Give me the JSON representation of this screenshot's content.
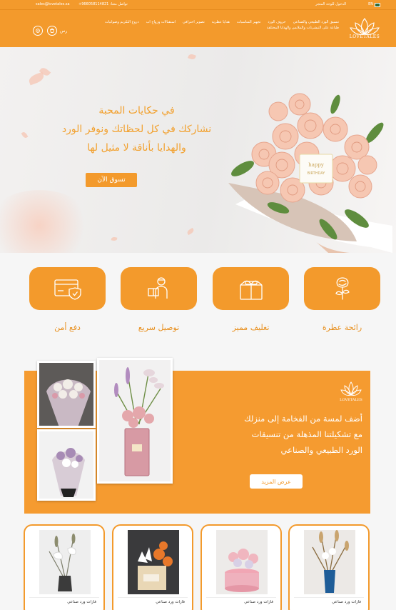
{
  "topbar": {
    "email": "sales@lovetales.sa",
    "phone": "+966058114821 :تواصل معنا",
    "login": "الدخول للوحة المتجر",
    "lang": "EN"
  },
  "header": {
    "logo_text": "LOVETALES",
    "nav": [
      "تنسيق الورد الطبيعي والصناعي",
      "حروف الورد",
      "تجهيز المناسبات",
      "هدايا عطرية",
      "تصوير احترافي",
      "استقبالات وزواج اب",
      "دروع التكريم وصوانيات",
      "طباعة على التيشرتات والملابس والهدايا المختلفة"
    ],
    "cart_label": "رس"
  },
  "hero": {
    "line1": "في حكايات المحبة",
    "line2": "نشاركك في كل لحظاتك ونوفر الورد",
    "line3": "والهدايا بأناقة لا مثيل لها",
    "shop_button": "تسوق الآن",
    "card_text": "happy BIRTHDAY"
  },
  "features": [
    {
      "label": "رائحة عطرة",
      "icon": "rose-icon"
    },
    {
      "label": "تغليف مميز",
      "icon": "gift-box-icon"
    },
    {
      "label": "توصيل سريع",
      "icon": "delivery-man-icon"
    },
    {
      "label": "دفع أمن",
      "icon": "secure-card-icon"
    }
  ],
  "promo": {
    "logo_text": "LOVETALES",
    "line1": "أضف لمسة من الفخامة إلى منزلك",
    "line2": "مع تشكيلتنا المذهلة من تنسيقات",
    "line3": "الورد الطبيعي والصناعي",
    "more_button": "عرض المزيد"
  },
  "products": [
    {
      "name": "فازات ورد صناعي"
    },
    {
      "name": "فازات ورد صناعي"
    },
    {
      "name": "فازات ورد صناعي"
    },
    {
      "name": "فازات ورد صناعي"
    }
  ],
  "colors": {
    "accent": "#f39a2c",
    "accent_dark": "#e8901f",
    "background": "#f6f6f6"
  }
}
